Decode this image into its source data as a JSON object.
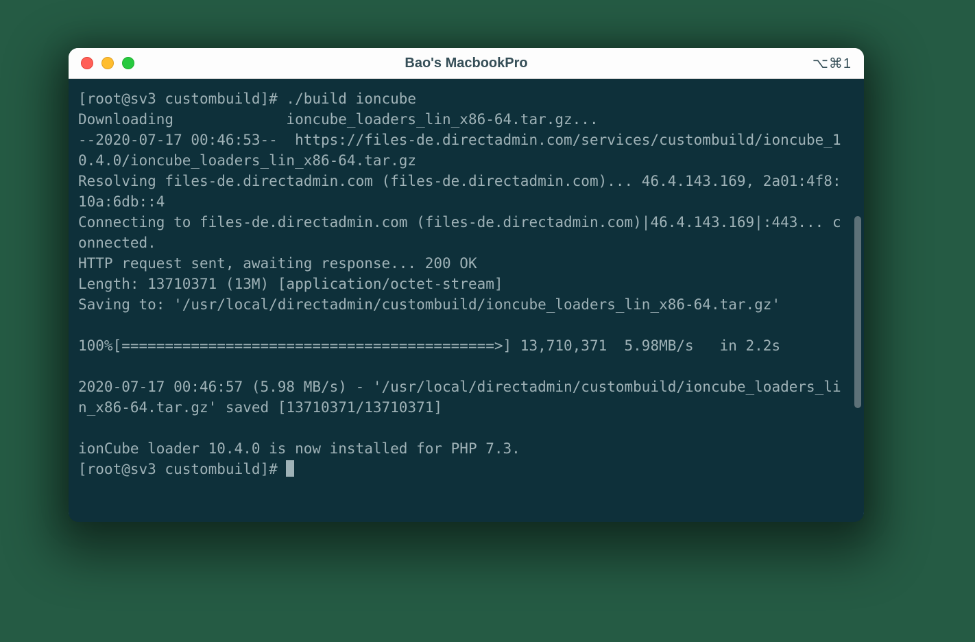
{
  "window": {
    "title": "Bao's MacbookPro",
    "shortcut": "⌥⌘1"
  },
  "terminal": {
    "lines": [
      "[root@sv3 custombuild]# ./build ioncube",
      "Downloading             ioncube_loaders_lin_x86-64.tar.gz...",
      "--2020-07-17 00:46:53--  https://files-de.directadmin.com/services/custombuild/ioncube_10.4.0/ioncube_loaders_lin_x86-64.tar.gz",
      "Resolving files-de.directadmin.com (files-de.directadmin.com)... 46.4.143.169, 2a01:4f8:10a:6db::4",
      "Connecting to files-de.directadmin.com (files-de.directadmin.com)|46.4.143.169|:443... connected.",
      "HTTP request sent, awaiting response... 200 OK",
      "Length: 13710371 (13M) [application/octet-stream]",
      "Saving to: '/usr/local/directadmin/custombuild/ioncube_loaders_lin_x86-64.tar.gz'",
      "",
      "100%[===========================================>] 13,710,371  5.98MB/s   in 2.2s",
      "",
      "2020-07-17 00:46:57 (5.98 MB/s) - '/usr/local/directadmin/custombuild/ioncube_loaders_lin_x86-64.tar.gz' saved [13710371/13710371]",
      "",
      "ionCube loader 10.4.0 is now installed for PHP 7.3."
    ],
    "prompt": "[root@sv3 custombuild]# "
  }
}
